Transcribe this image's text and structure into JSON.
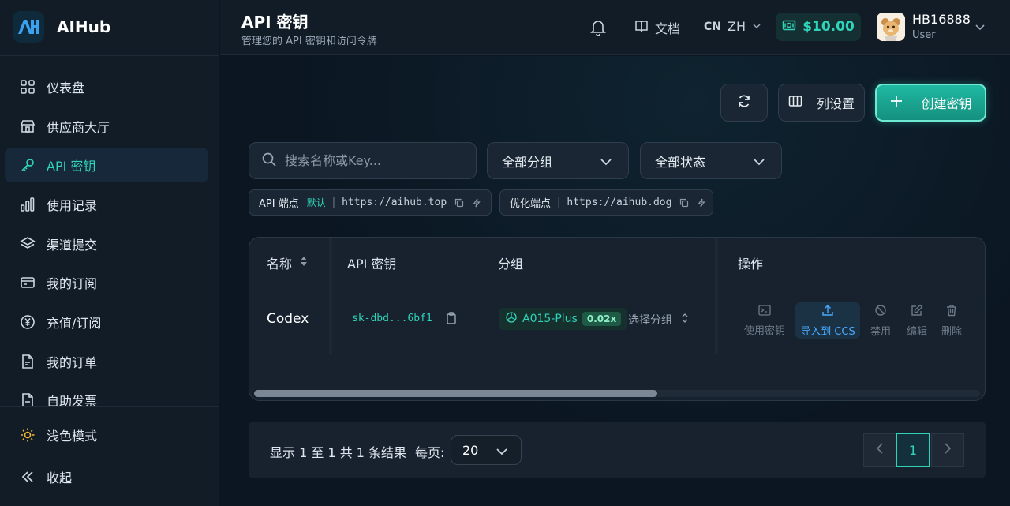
{
  "brand": {
    "name": "AIHub"
  },
  "sidebar": {
    "items": [
      {
        "label": "仪表盘",
        "icon": "dashboard-icon"
      },
      {
        "label": "供应商大厅",
        "icon": "store-icon"
      },
      {
        "label": "API 密钥",
        "icon": "key-icon",
        "active": true
      },
      {
        "label": "使用记录",
        "icon": "bar-chart-icon"
      },
      {
        "label": "渠道提交",
        "icon": "layers-icon"
      },
      {
        "label": "我的订阅",
        "icon": "credit-card-icon"
      },
      {
        "label": "充值/订阅",
        "icon": "yen-coin-icon"
      },
      {
        "label": "我的订单",
        "icon": "document-icon"
      },
      {
        "label": "自助发票",
        "icon": "invoice-icon"
      }
    ],
    "theme_toggle": "浅色模式",
    "collapse": "收起"
  },
  "header": {
    "title": "API 密钥",
    "subtitle": "管理您的 API 密钥和访问令牌",
    "docs": "文档",
    "lang_code": "CN",
    "lang": "ZH",
    "balance": "$10.00",
    "user_name": "HB16888",
    "user_role": "User"
  },
  "toolbar": {
    "columns_label": "列设置",
    "create_label": "创建密钥"
  },
  "filters": {
    "search_placeholder": "搜索名称或Key...",
    "group_select": "全部分组",
    "status_select": "全部状态"
  },
  "endpoints": [
    {
      "label": "API 端点",
      "tag": "默认",
      "url": "https://aihub.top"
    },
    {
      "label": "优化端点",
      "tag": "",
      "url": "https://aihub.dog"
    }
  ],
  "table": {
    "headers": {
      "name": "名称",
      "key": "API 密钥",
      "group": "分组",
      "actions": "操作"
    },
    "rows": [
      {
        "name": "Codex",
        "key": "sk-dbd...6bf1",
        "group": "A015-Plus",
        "multiplier": "0.02x",
        "select_group": "选择分组"
      }
    ],
    "actions": [
      "使用密钥",
      "导入到 CCS",
      "禁用",
      "编辑",
      "删除"
    ]
  },
  "pagination": {
    "summary": "显示 1 至 1 共 1 条结果",
    "per_page_label": "每页:",
    "per_page": "20",
    "current_page": "1"
  },
  "colors": {
    "accent": "#2fd3b8",
    "background": "#0b1622",
    "panel": "#17222e",
    "link_blue": "#4aa9ff"
  }
}
